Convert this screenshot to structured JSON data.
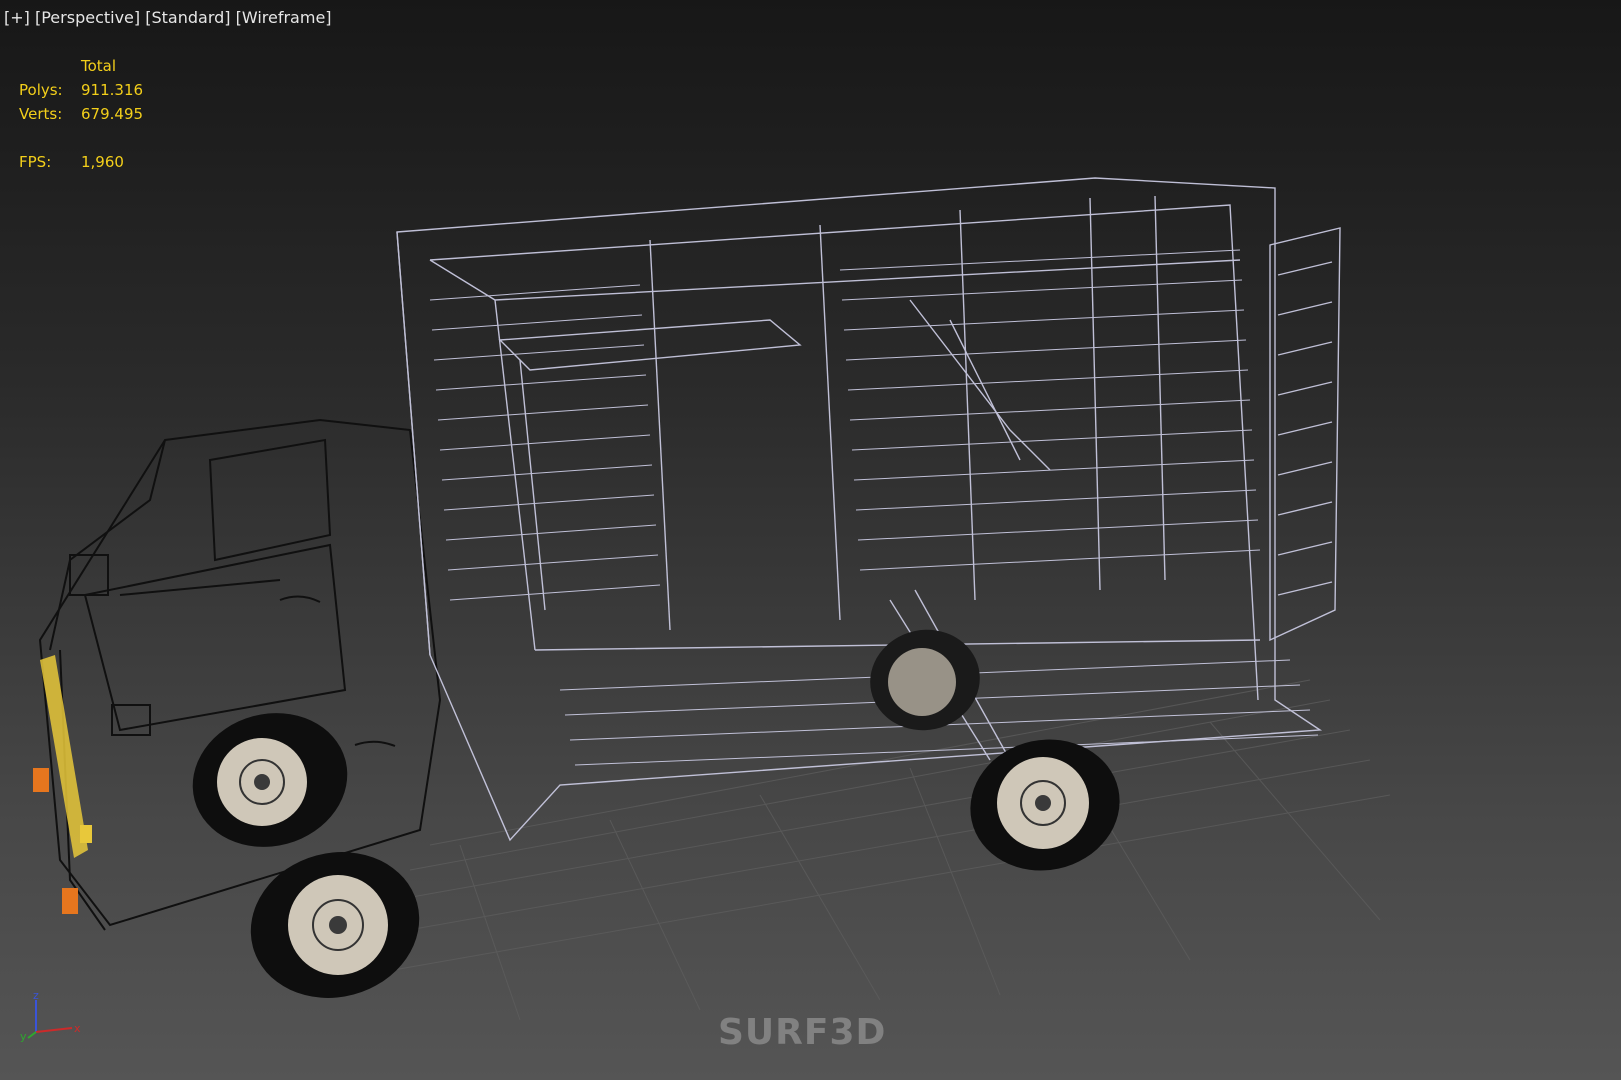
{
  "viewport": {
    "labels": [
      "[+]",
      "[Perspective]",
      "[Standard]",
      "[Wireframe]"
    ]
  },
  "stats": {
    "header": "Total",
    "polys_label": "Polys:",
    "polys_value": "911.316",
    "verts_label": "Verts:",
    "verts_value": "679.495",
    "fps_label": "FPS:",
    "fps_value": "1,960"
  },
  "axis": {
    "x": "x",
    "y": "y",
    "z": "z"
  },
  "watermark": "SURF3D",
  "colors": {
    "stats_text": "#f3cf1a",
    "wire": "#c8c8e0",
    "grid": "#5e5e5e",
    "tire": "#0e0e0e",
    "wheel_rim": "#cfc7b8",
    "light_orange": "#e6761e",
    "light_yellow": "#e8c83a",
    "axis_x": "#cc2a2a",
    "axis_y": "#2ea82e",
    "axis_z": "#3a54d8"
  }
}
